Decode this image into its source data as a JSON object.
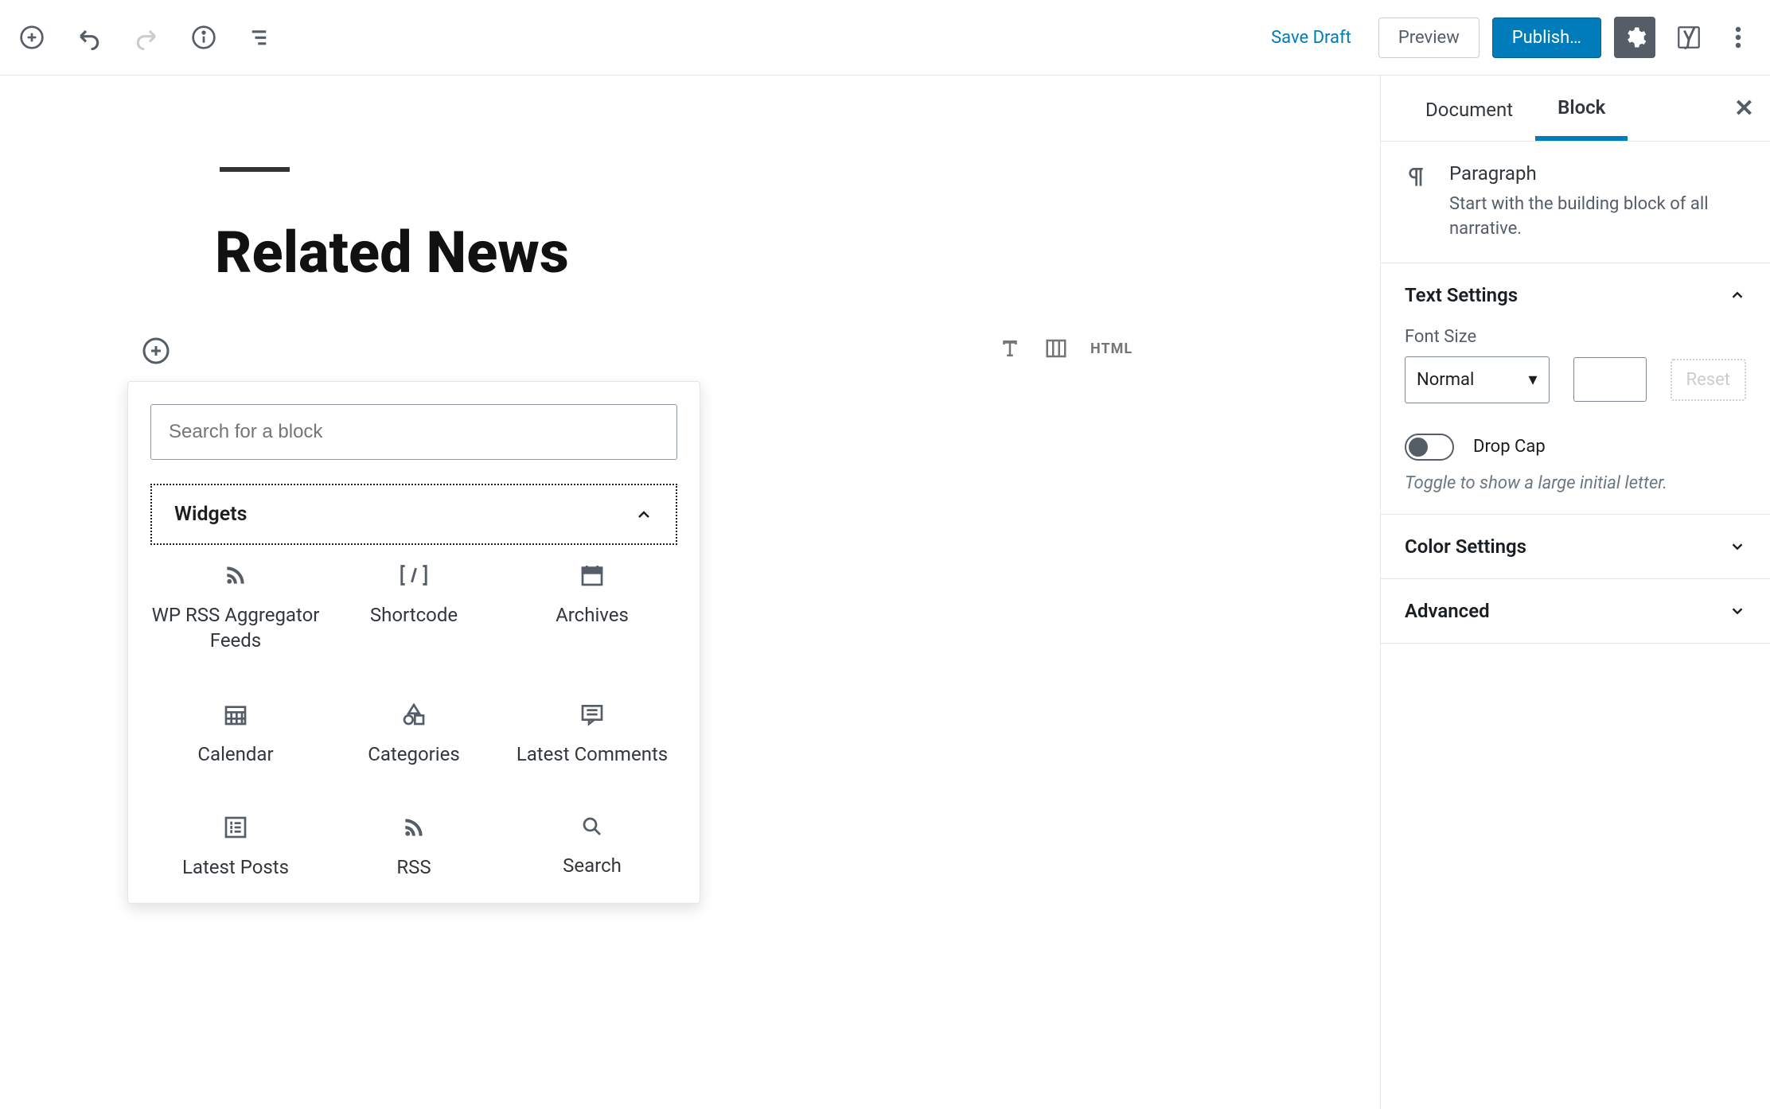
{
  "toolbar": {
    "save_draft": "Save Draft",
    "preview": "Preview",
    "publish": "Publish…"
  },
  "post": {
    "title": "Related News"
  },
  "inline_toolbar": {
    "html_label": "HTML"
  },
  "popover": {
    "search_placeholder": "Search for a block",
    "section_label": "Widgets",
    "items": [
      {
        "label": "WP RSS Aggregator Feeds",
        "icon": "rss-feed-icon"
      },
      {
        "label": "Shortcode",
        "icon": "shortcode-icon"
      },
      {
        "label": "Archives",
        "icon": "archives-icon"
      },
      {
        "label": "Calendar",
        "icon": "calendar-icon"
      },
      {
        "label": "Categories",
        "icon": "categories-icon"
      },
      {
        "label": "Latest Comments",
        "icon": "comments-icon"
      },
      {
        "label": "Latest Posts",
        "icon": "latest-posts-icon"
      },
      {
        "label": "RSS",
        "icon": "rss-icon"
      },
      {
        "label": "Search",
        "icon": "search-icon"
      }
    ]
  },
  "sidebar": {
    "tabs": {
      "document": "Document",
      "block": "Block"
    },
    "block_info": {
      "name": "Paragraph",
      "desc": "Start with the building block of all narrative."
    },
    "text_settings": {
      "title": "Text Settings",
      "font_size_label": "Font Size",
      "font_size_value": "Normal",
      "reset_label": "Reset",
      "drop_cap_label": "Drop Cap",
      "drop_cap_hint": "Toggle to show a large initial letter."
    },
    "color_settings": {
      "title": "Color Settings"
    },
    "advanced": {
      "title": "Advanced"
    }
  }
}
